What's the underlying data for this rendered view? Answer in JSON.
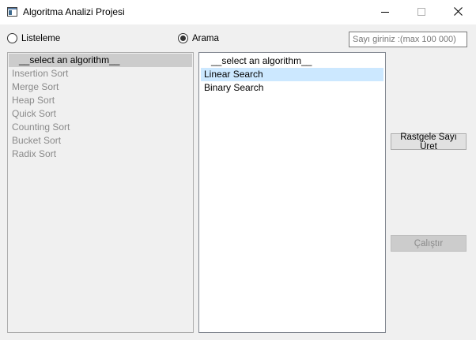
{
  "window": {
    "title": "Algoritma Analizi Projesi",
    "icons": {
      "app": "app-window-icon",
      "minimize": "minimize-icon",
      "maximize": "maximize-icon",
      "close": "close-icon"
    }
  },
  "mode": {
    "options": [
      {
        "label": "Listeleme",
        "checked": false
      },
      {
        "label": "Arama",
        "checked": true
      }
    ]
  },
  "number_input": {
    "value": "",
    "placeholder": "Sayı giriniz :(max 100 000)"
  },
  "sort_list": {
    "header": "__select an algorithm__",
    "items": [
      "Insertion Sort",
      "Merge Sort",
      "Heap Sort",
      "Quick Sort",
      "Counting Sort",
      "Bucket Sort",
      "Radix Sort"
    ],
    "enabled": false
  },
  "search_list": {
    "header": "__select an algorithm__",
    "items": [
      "Linear Search",
      "Binary Search"
    ],
    "selected_index": 0
  },
  "buttons": {
    "random_label": "Rastgele Sayı Üret",
    "run_label": "Çalıştır",
    "run_enabled": false
  },
  "colors": {
    "selection": "#cce8ff",
    "disabled_text": "#8a8a8a",
    "header_bg": "#cccccc"
  }
}
